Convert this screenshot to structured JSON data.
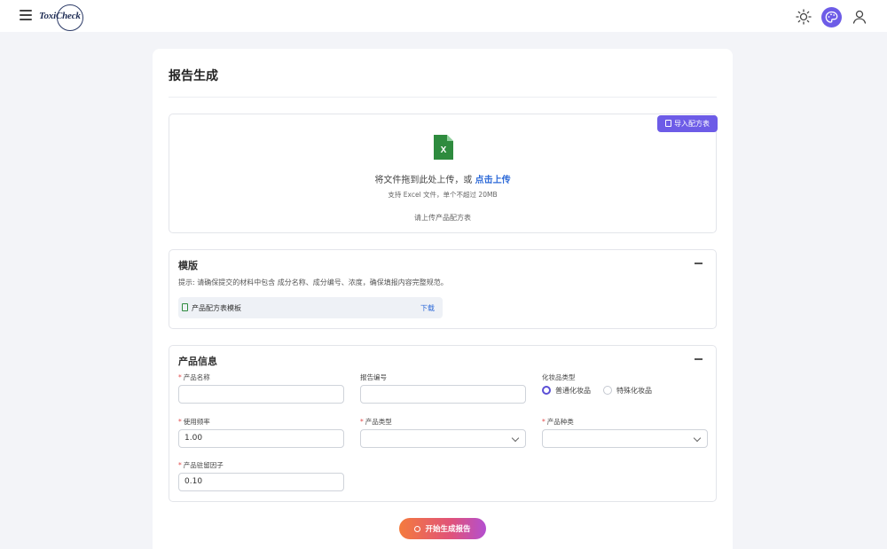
{
  "app": {
    "logo_text": "ToxiCheck"
  },
  "page": {
    "title": "报告生成"
  },
  "upload": {
    "import_button": "导入配方表",
    "drop_text": "将文件拖到此处上传，或",
    "drop_link": "点击上传",
    "hint": "支持 Excel 文件，单个不超过 20MB",
    "message": "请上传产品配方表"
  },
  "template_panel": {
    "title": "模版",
    "tip": "提示: 请确保提交的材料中包含 成分名称、成分编号、浓度，确保填报内容完整规范。",
    "file_name": "产品配方表模板",
    "download": "下载"
  },
  "product_panel": {
    "title": "产品信息",
    "fields": {
      "product_name": {
        "label": "产品名称",
        "required": true,
        "value": ""
      },
      "report_no": {
        "label": "报告编号",
        "required": false,
        "value": ""
      },
      "cosmetic_type": {
        "label": "化妆品类型",
        "options": [
          "普通化妆品",
          "特殊化妆品"
        ],
        "selected": "普通化妆品"
      },
      "usage_freq": {
        "label": "使用频率",
        "required": true,
        "value": "1.00"
      },
      "product_type": {
        "label": "产品类型",
        "required": true,
        "value": ""
      },
      "product_kind": {
        "label": "产品种类",
        "required": true,
        "value": ""
      },
      "retention": {
        "label": "产品驻留因子",
        "required": true,
        "value": "0.10"
      }
    }
  },
  "actions": {
    "generate": "开始生成报告"
  },
  "colors": {
    "accent": "#6d5ce7",
    "link": "#2f6bd8",
    "required": "#e24c4c",
    "excel": "#2e8b3e"
  }
}
